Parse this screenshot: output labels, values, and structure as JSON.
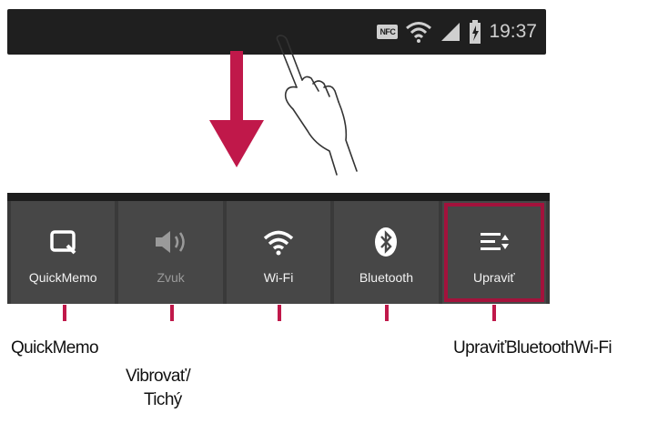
{
  "status_bar": {
    "nfc_label": "NFC",
    "time": "19:37"
  },
  "quick_settings": [
    {
      "label": "QuickMemo",
      "icon": "quickmemo-icon",
      "dim": false
    },
    {
      "label": "Zvuk",
      "icon": "speaker-icon",
      "dim": true
    },
    {
      "label": "Wi-Fi",
      "icon": "wifi-icon",
      "dim": false
    },
    {
      "label": "Bluetooth",
      "icon": "bluetooth-icon",
      "dim": false
    },
    {
      "label": "Upraviť",
      "icon": "edit-list-icon",
      "dim": false,
      "highlighted": true
    }
  ],
  "callouts": {
    "quickmemo": "QuickMemo",
    "vibrovat_line1": "Vibrovať/",
    "vibrovat_line2": "Tichý",
    "upravit": "UpraviťBluetoothWi-Fi"
  },
  "colors": {
    "accent": "#c0184a",
    "highlight_border": "#a3123c",
    "status_bar_bg": "#1f1f1f",
    "tile_bg": "#474747"
  }
}
